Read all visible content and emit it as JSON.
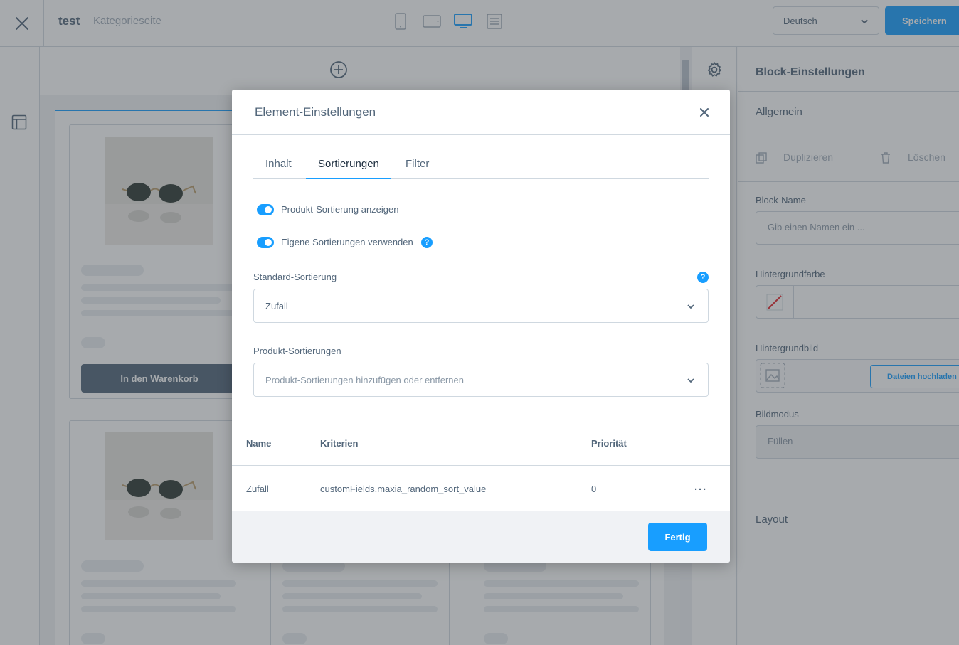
{
  "header": {
    "title": "test",
    "subtitle": "Kategorieseite",
    "language": "Deutsch",
    "save_label": "Speichern"
  },
  "canvas": {
    "cart_button_label": "In den Warenkorb"
  },
  "sidebar": {
    "title": "Block-Einstellungen",
    "general_section": "Allgemein",
    "duplicate_label": "Duplizieren",
    "delete_label": "Löschen",
    "block_name_label": "Block-Name",
    "block_name_placeholder": "Gib einen Namen ein ...",
    "bg_color_label": "Hintergrundfarbe",
    "bg_image_label": "Hintergrundbild",
    "upload_label": "Dateien hochladen",
    "image_mode_label": "Bildmodus",
    "image_mode_value": "Füllen",
    "layout_section": "Layout"
  },
  "modal": {
    "title": "Element-Einstellungen",
    "tabs": [
      {
        "label": "Inhalt",
        "active": false
      },
      {
        "label": "Sortierungen",
        "active": true
      },
      {
        "label": "Filter",
        "active": false
      }
    ],
    "toggles": [
      {
        "label": "Produkt-Sortierung anzeigen",
        "on": true
      },
      {
        "label": "Eigene Sortierungen verwenden",
        "on": true
      }
    ],
    "default_sort_label": "Standard-Sortierung",
    "default_sort_value": "Zufall",
    "product_sorts_label": "Produkt-Sortierungen",
    "product_sorts_placeholder": "Produkt-Sortierungen hinzufügen oder entfernen",
    "table": {
      "columns": [
        "Name",
        "Kriterien",
        "Priorität"
      ],
      "rows": [
        {
          "name": "Zufall",
          "criteria": "customFields.maxia_random_sort_value",
          "priority": "0"
        }
      ]
    },
    "done_label": "Fertig"
  },
  "colors": {
    "accent": "#189eff",
    "text": "#52667a",
    "border": "#d1d9e0"
  }
}
